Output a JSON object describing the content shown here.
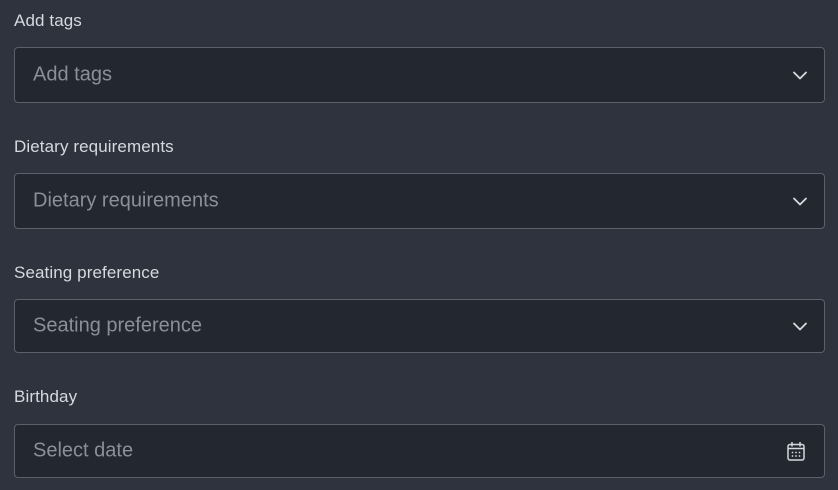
{
  "form": {
    "tags": {
      "label": "Add tags",
      "placeholder": "Add tags",
      "icon": "chevron-down-icon"
    },
    "dietary": {
      "label": "Dietary requirements",
      "placeholder": "Dietary requirements",
      "icon": "chevron-down-icon"
    },
    "seating": {
      "label": "Seating preference",
      "placeholder": "Seating preference",
      "icon": "chevron-down-icon"
    },
    "birthday": {
      "label": "Birthday",
      "placeholder": "Select date",
      "icon": "calendar-icon"
    }
  },
  "colors": {
    "background": "#2e333d",
    "field_background": "#23272f",
    "field_border": "#5b616b",
    "label_text": "#d6d9de",
    "placeholder_text": "#8a9099"
  }
}
